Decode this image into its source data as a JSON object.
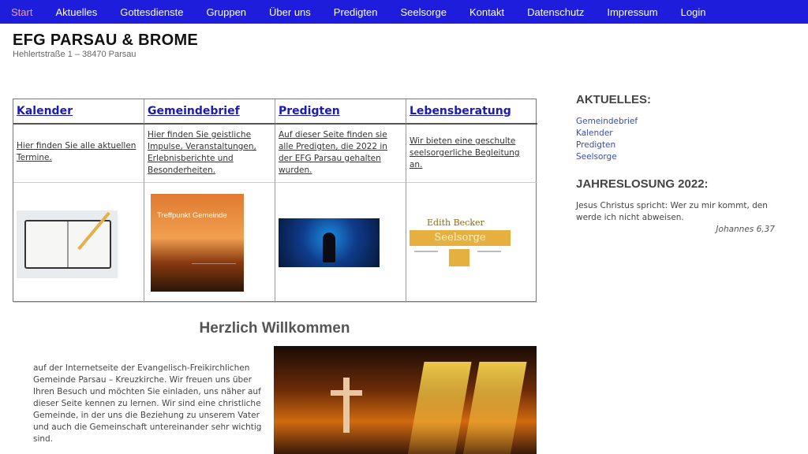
{
  "nav": {
    "items": [
      "Start",
      "Aktuelles",
      "Gottesdienste",
      "Gruppen",
      "Über uns",
      "Predigten",
      "Seelsorge",
      "Kontakt",
      "Datenschutz",
      "Impressum",
      "Login"
    ],
    "active_index": 0,
    "colors": {
      "background": "#1d1ddb",
      "active_text": "#ff9e9e",
      "text": "#ffffff"
    }
  },
  "site": {
    "title": "EFG PARSAU & BROME",
    "address": "Hehlertstraße 1 – 38470 Parsau"
  },
  "grid": {
    "columns": [
      {
        "heading": "Kalender",
        "description": "Hier finden Sie alle aktuellen Termine.",
        "image_icon": "calendar-notebook-image"
      },
      {
        "heading": "Gemeindebrief",
        "description": "Hier finden Sie geistliche Impulse, Veranstaltungen, Erlebnisberichte und Besonderheiten.",
        "image_icon": "treffpunkt-gemeinde-cover-image",
        "image_text": "Treffpunkt Gemeinde"
      },
      {
        "heading": "Predigten",
        "description": "Auf dieser Seite finden sie alle Predigten, die 2022 in der EFG Parsau gehalten wurden.",
        "image_icon": "preacher-stage-image"
      },
      {
        "heading": "Lebensberatung",
        "description": "Wir bieten eine geschulte seelsorgerliche Begleitung an.",
        "image_icon": "seelsorge-card-image",
        "image_text_name": "Edith Becker",
        "image_text_band": "Seelsorge"
      }
    ]
  },
  "welcome": {
    "title": "Herzlich Willkommen",
    "text": "auf der Internetseite der Evangelisch-Freikirchlichen Gemeinde Parsau – Kreuzkirche. Wir freuen uns über Ihren Besuch und möchten Sie einladen, uns näher auf dieser Seite kennen zu lernen. Wir sind eine christliche Gemeinde, in der uns die Beziehung zu unserem Vater und auch die Gemeinschaft untereinander sehr wichtig sind."
  },
  "sidebar": {
    "aktuelles_heading": "AKTUELLES:",
    "links": [
      "Gemeindebrief",
      "Kalender",
      "Predigten",
      "Seelsorge"
    ],
    "jahreslosung_heading": "JAHRESLOSUNG 2022:",
    "jahreslosung_text": "Jesus Christus spricht: Wer zu mir kommt, den werde ich nicht abweisen.",
    "jahreslosung_ref": "Johannes 6,37"
  }
}
